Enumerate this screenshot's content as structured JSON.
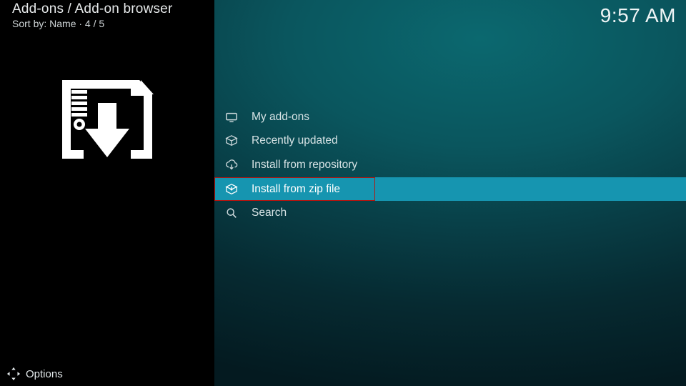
{
  "header": {
    "breadcrumb": "Add-ons / Add-on browser",
    "sort_line": "Sort by: Name  ·  4 / 5"
  },
  "clock": "9:57 AM",
  "menu": {
    "items": [
      {
        "label": "My add-ons",
        "icon": "tv-icon"
      },
      {
        "label": "Recently updated",
        "icon": "box-icon"
      },
      {
        "label": "Install from repository",
        "icon": "cloud-down-icon"
      },
      {
        "label": "Install from zip file",
        "icon": "zip-install-icon"
      },
      {
        "label": "Search",
        "icon": "search-icon"
      }
    ],
    "selected_index": 3
  },
  "footer": {
    "options_label": "Options"
  }
}
